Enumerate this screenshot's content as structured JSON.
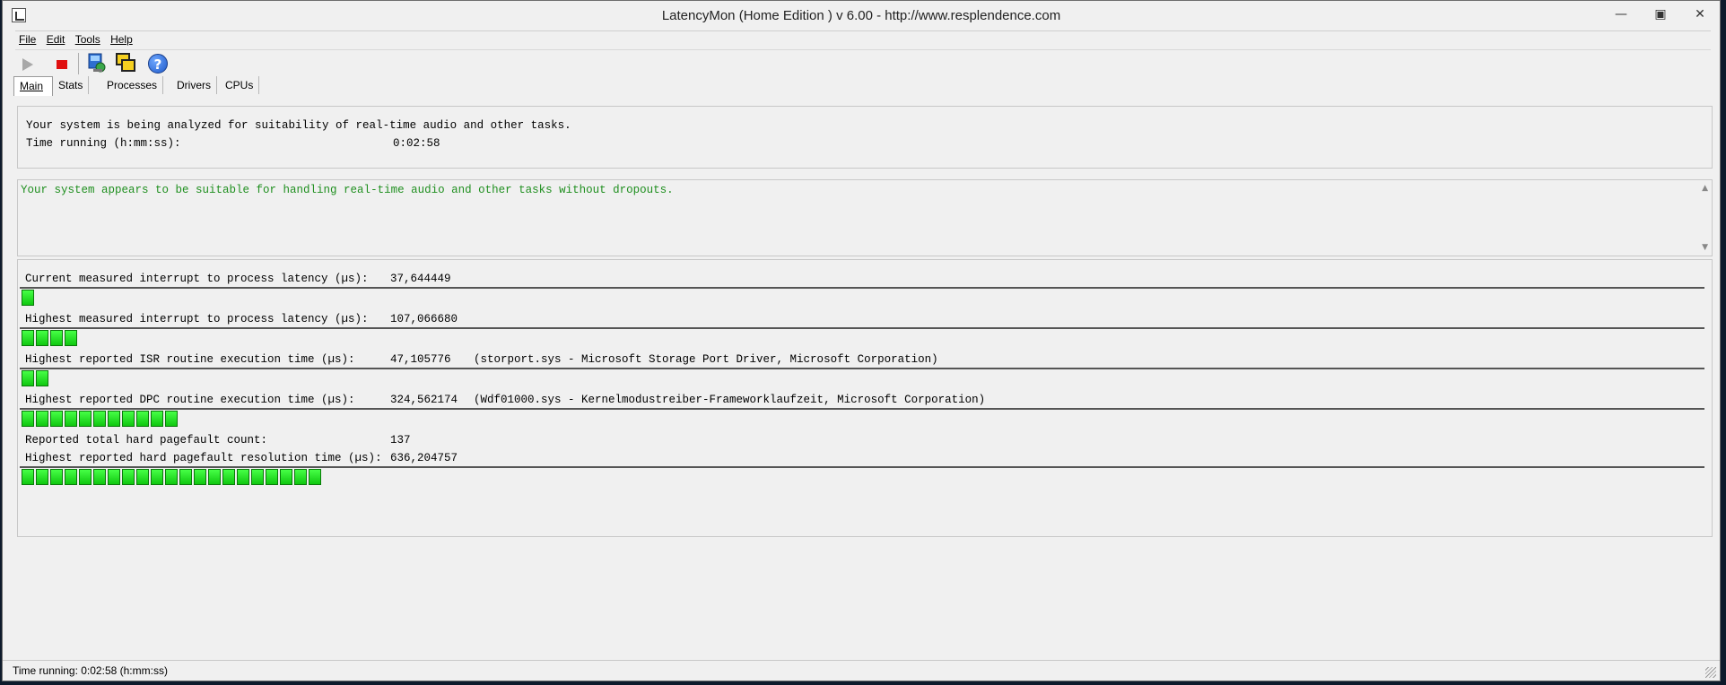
{
  "window": {
    "title": "LatencyMon  (Home Edition )  v 6.00 - http://www.resplendence.com"
  },
  "menu": [
    "File",
    "Edit",
    "Tools",
    "Help"
  ],
  "toolbar": {
    "buttons": [
      "play-icon",
      "stop-icon",
      "settings-icon",
      "windows-icon",
      "help-icon"
    ]
  },
  "tabs": [
    "Main",
    "Stats",
    "Processes",
    "Drivers",
    "CPUs"
  ],
  "status_panel": {
    "line1": "Your system is being analyzed for suitability of real-time audio and other tasks.",
    "time_label": "Time running (h:mm:ss):",
    "time_value": "0:02:58"
  },
  "verdict": "Your system appears to be suitable for handling real-time audio and other tasks without dropouts.",
  "metrics": [
    {
      "label": "Current measured interrupt to process latency (µs):",
      "value": "37,644449",
      "detail": "",
      "segments": 1
    },
    {
      "label": "Highest measured interrupt to process latency (µs):",
      "value": "107,066680",
      "detail": "",
      "segments": 4
    },
    {
      "label": "Highest reported ISR routine execution time (µs):",
      "value": "47,105776",
      "detail": "(storport.sys - Microsoft Storage Port Driver, Microsoft Corporation)",
      "segments": 2
    },
    {
      "label": "Highest reported DPC routine execution time (µs):",
      "value": "324,562174",
      "detail": "(Wdf01000.sys - Kernelmodustreiber-Frameworklaufzeit, Microsoft Corporation)",
      "segments": 11
    }
  ],
  "pagefault_count": {
    "label": "Reported total hard pagefault count:",
    "value": "137"
  },
  "pagefault_time": {
    "label": "Highest reported hard pagefault resolution time (µs):",
    "value": "636,204757",
    "segments": 21
  },
  "statusbar": "Time running: 0:02:58  (h:mm:ss)"
}
